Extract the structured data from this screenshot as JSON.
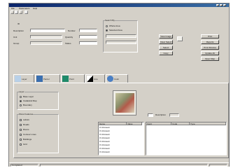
{
  "window": {
    "title": ""
  },
  "menu": {
    "items": [
      "File",
      "Parameters",
      "Help"
    ]
  },
  "form": {
    "id_label": "ID",
    "description_label": "Description",
    "number_label": "Number",
    "unit_label": "Unit",
    "quantity_label": "Quantity",
    "group_label": "Group",
    "status_label": "Status"
  },
  "query_group": {
    "title": "Search By",
    "options": [
      "Whole Area",
      "Selected Area"
    ],
    "selected_index": 1
  },
  "buttons": {
    "view_image": "View Image",
    "clear_select": "Clear Select",
    "select": "Select",
    "copy": "Copy",
    "print": "Print",
    "reports": "Reports",
    "print_window": "Print Window",
    "update_all": "Update All",
    "open_map": "Open Map"
  },
  "tabs": [
    "Layer",
    "Parcel",
    "Point",
    "Line",
    "Color"
  ],
  "layer_group": {
    "title": "Layer",
    "options": [
      "Base Layer",
      "Cadastral Map",
      "Boundary"
    ],
    "selected_index": 1
  },
  "checks": {
    "title": "Show Features",
    "items": [
      "Labels",
      "Roads",
      "Rivers",
      "Contour Lines",
      "Buildings",
      "Grid"
    ]
  },
  "grid1": {
    "headers": [
      "Name",
      "Value"
    ],
    "rows": [
      "0 Unknown",
      "0 Unknown",
      "0 Unknown",
      "0 Unknown",
      "0 Unknown",
      "0 Unknown",
      "0 Unknown",
      "0 Unknown"
    ]
  },
  "grid2": {
    "headers": [
      "Field",
      "Code",
      "Type"
    ]
  },
  "side_field": {
    "label": "Description"
  },
  "status": {
    "text": "Completed"
  }
}
